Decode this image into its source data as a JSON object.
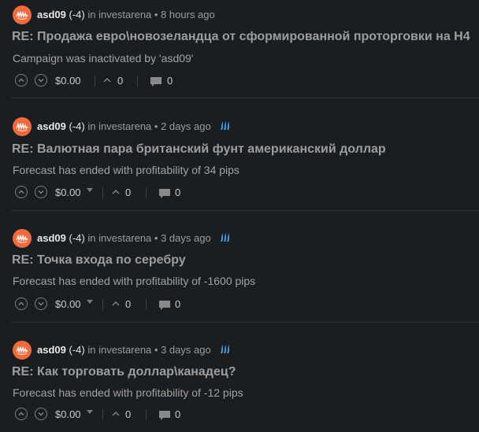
{
  "posts": [
    {
      "author": "asd09",
      "reputation": "(-4)",
      "community_prefix": "in investarena",
      "time": "• 8 hours ago",
      "has_steem_icon": false,
      "title": "RE: Продажа евро\\новозеландца от сформированной проторговки на H4",
      "body": "Campaign was inactivated by 'asd09'",
      "payout": "$0.00",
      "has_payout_caret": false,
      "votes": "0",
      "comments": "0"
    },
    {
      "author": "asd09",
      "reputation": "(-4)",
      "community_prefix": "in investarena",
      "time": "• 2 days ago",
      "has_steem_icon": true,
      "title": "RE: Валютная пара британский фунт американский доллар",
      "body": "Forecast has ended with profitability of 34 pips",
      "payout": "$0.00",
      "has_payout_caret": true,
      "votes": "0",
      "comments": "0"
    },
    {
      "author": "asd09",
      "reputation": "(-4)",
      "community_prefix": "in investarena",
      "time": "• 3 days ago",
      "has_steem_icon": true,
      "title": "RE: Точка входа по серебру",
      "body": "Forecast has ended with profitability of -1600 pips",
      "payout": "$0.00",
      "has_payout_caret": true,
      "votes": "0",
      "comments": "0"
    },
    {
      "author": "asd09",
      "reputation": "(-4)",
      "community_prefix": "in investarena",
      "time": "• 3 days ago",
      "has_steem_icon": true,
      "title": "RE: Как торговать доллар\\канадец?",
      "body": "Forecast has ended with profitability of -12 pips",
      "payout": "$0.00",
      "has_payout_caret": true,
      "votes": "0",
      "comments": "0"
    }
  ],
  "colors": {
    "background": "#1b1e21",
    "avatar": "#f26a3c",
    "steem_icon": "#4ba2f2"
  },
  "icons": [
    "avatar-icon",
    "steem-icon",
    "upvote-icon",
    "downvote-icon",
    "voters-icon",
    "comment-icon"
  ]
}
